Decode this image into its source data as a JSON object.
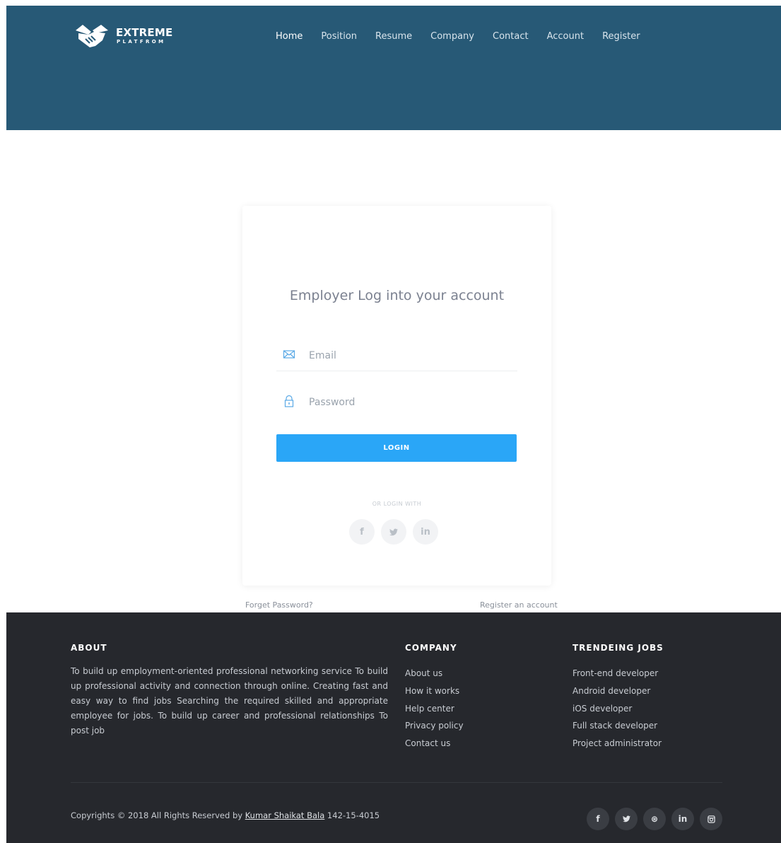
{
  "brand": {
    "title": "EXTREME",
    "subtitle": "PLATFROM",
    "logo_icon": "handshake-icon"
  },
  "nav": {
    "items": [
      {
        "label": "Home",
        "active": true
      },
      {
        "label": "Position"
      },
      {
        "label": "Resume"
      },
      {
        "label": "Company"
      },
      {
        "label": "Contact"
      },
      {
        "label": "Account"
      },
      {
        "label": "Register"
      }
    ]
  },
  "login": {
    "title": "Employer Log into your account",
    "email_placeholder": "Email",
    "password_placeholder": "Password",
    "button_label": "LOGIN",
    "or_login_with": "OR LOGIN WITH",
    "socials": [
      {
        "icon": "facebook-icon",
        "glyph": "f"
      },
      {
        "icon": "twitter-icon",
        "glyph": "🐦"
      },
      {
        "icon": "linkedin-icon",
        "glyph": "in"
      }
    ],
    "forget_password": "Forget Password?",
    "register_account": "Register an account"
  },
  "footer": {
    "about": {
      "heading": "ABOUT",
      "text": "To build up employment-oriented professional networking service To build up professional activity and connection through online. Creating fast and easy way to find jobs Searching the required skilled and appropriate employee for jobs. To build up career and professional relationships To post job"
    },
    "company": {
      "heading": "COMPANY",
      "links": [
        "About us",
        "How it works",
        "Help center",
        "Privacy policy",
        "Contact us"
      ]
    },
    "jobs": {
      "heading": "TRENDEING JOBS",
      "links": [
        "Front-end developer",
        "Android developer",
        "iOS developer",
        "Full stack developer",
        "Project administrator"
      ]
    },
    "copyright_prefix": "Copyrights © 2018 All Rights Reserved by ",
    "copyright_author": "Kumar Shaikat Bala",
    "copyright_suffix": " 142-15-4015",
    "socials": [
      {
        "icon": "facebook-icon",
        "glyph": "f"
      },
      {
        "icon": "twitter-icon",
        "glyph": "🐦"
      },
      {
        "icon": "dribbble-icon",
        "glyph": "⊛"
      },
      {
        "icon": "linkedin-icon",
        "glyph": "in"
      },
      {
        "icon": "instagram-icon",
        "glyph": "◘"
      }
    ]
  },
  "colors": {
    "header_bg": "#275976",
    "button_bg": "#2aa6f7",
    "footer_bg": "#26282d"
  }
}
